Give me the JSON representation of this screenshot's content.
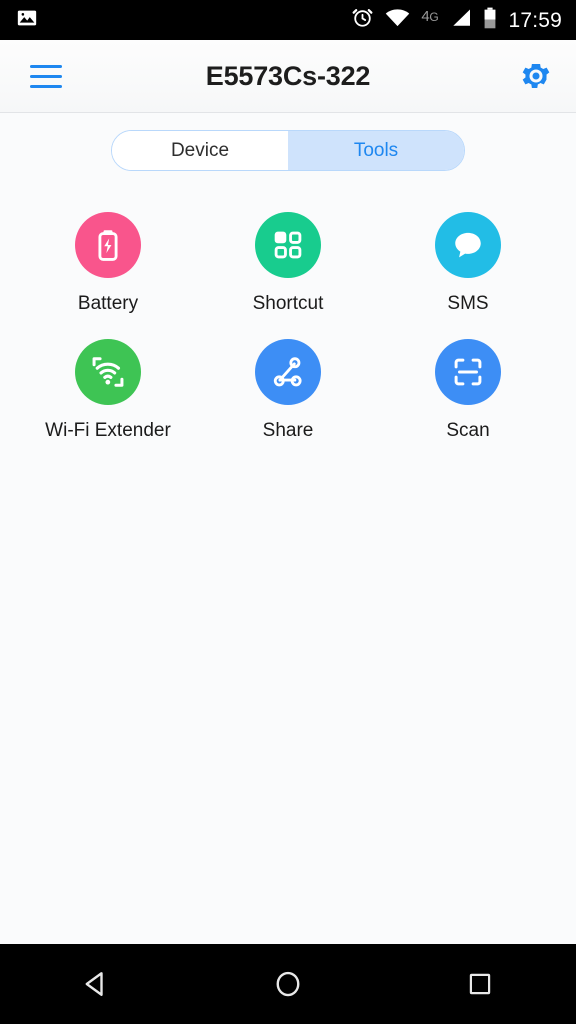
{
  "statusbar": {
    "gallery_icon": "image-icon",
    "alarm_icon": "alarm-clock-icon",
    "wifi_icon": "wifi-icon",
    "network_type": "4",
    "network_type_suffix": "G",
    "signal_icon": "cellular-signal-icon",
    "battery_icon": "battery-icon",
    "time": "17:59"
  },
  "header": {
    "menu_icon": "hamburger-menu-icon",
    "title": "E5573Cs-322",
    "settings_icon": "gear-icon",
    "accent_color": "#1e87f0"
  },
  "tabs": {
    "items": [
      {
        "label": "Device",
        "selected": false
      },
      {
        "label": "Tools",
        "selected": true
      }
    ],
    "selected_color": "#1e87f0",
    "selected_background": "#cfe3fc",
    "border_color": "#b9d8fb"
  },
  "tools": {
    "items": [
      {
        "label": "Battery",
        "icon": "battery-bolt-icon",
        "color": "#f9558c"
      },
      {
        "label": "Shortcut",
        "icon": "grid-squares-icon",
        "color": "#18cc8e"
      },
      {
        "label": "SMS",
        "icon": "speech-bubble-icon",
        "color": "#22bde6"
      },
      {
        "label": "Wi-Fi Extender",
        "icon": "wifi-extender-icon",
        "color": "#3ec454"
      },
      {
        "label": "Share",
        "icon": "share-nodes-icon",
        "color": "#3d8ef5"
      },
      {
        "label": "Scan",
        "icon": "scan-frame-icon",
        "color": "#3d8ef5"
      }
    ]
  },
  "navbar": {
    "back_icon": "back-triangle-icon",
    "home_icon": "home-circle-icon",
    "recents_icon": "recents-square-icon"
  }
}
